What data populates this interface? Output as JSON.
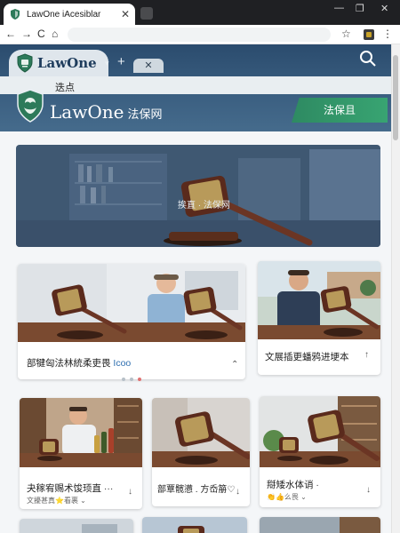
{
  "browser": {
    "tab_title": "LawOne iAcesiblar",
    "tab_close": "✕",
    "controls": {
      "minimize": "—",
      "maximize": "❐",
      "close": "✕"
    },
    "nav": {
      "back": "←",
      "forward": "→",
      "reload": "C",
      "home": "⌂"
    },
    "toolbar_icons": {
      "bookmark": "☆",
      "menu": "⋮"
    }
  },
  "site": {
    "app_tab_name": "LawOne",
    "app_tab_caret": "▾",
    "app_tab_plus": "+",
    "app_tab2_close": "✕",
    "subbar_label": "迭点",
    "brand_name": "LawOne",
    "brand_cn": "法保网",
    "cta_label": "法保且",
    "colors": {
      "header": "#2b4c6e",
      "accent_green": "#38a472",
      "text_link": "#2f6fb0"
    }
  },
  "hero": {
    "caption": "挨直 · 法保网"
  },
  "cards": [
    {
      "title": "部犍匈法林統柔吏畏",
      "extra": "Icoo",
      "chevron": "⌃"
    },
    {
      "title": "文展插更蟠鸦进埂本",
      "chevron": "↑"
    },
    {
      "title": "夬稼宥赐术馂顼直",
      "extra": "···",
      "sub": "文擾甚真⭐看裹 ⌄",
      "chevron": "↓"
    },
    {
      "title": "部覃髋懑 . 方岙笧♡",
      "chevron": "↓"
    },
    {
      "title": "搿矮水体诮",
      "extra": "·",
      "sub": "👏👍么畏 ⌄",
      "chevron": "↓"
    }
  ]
}
